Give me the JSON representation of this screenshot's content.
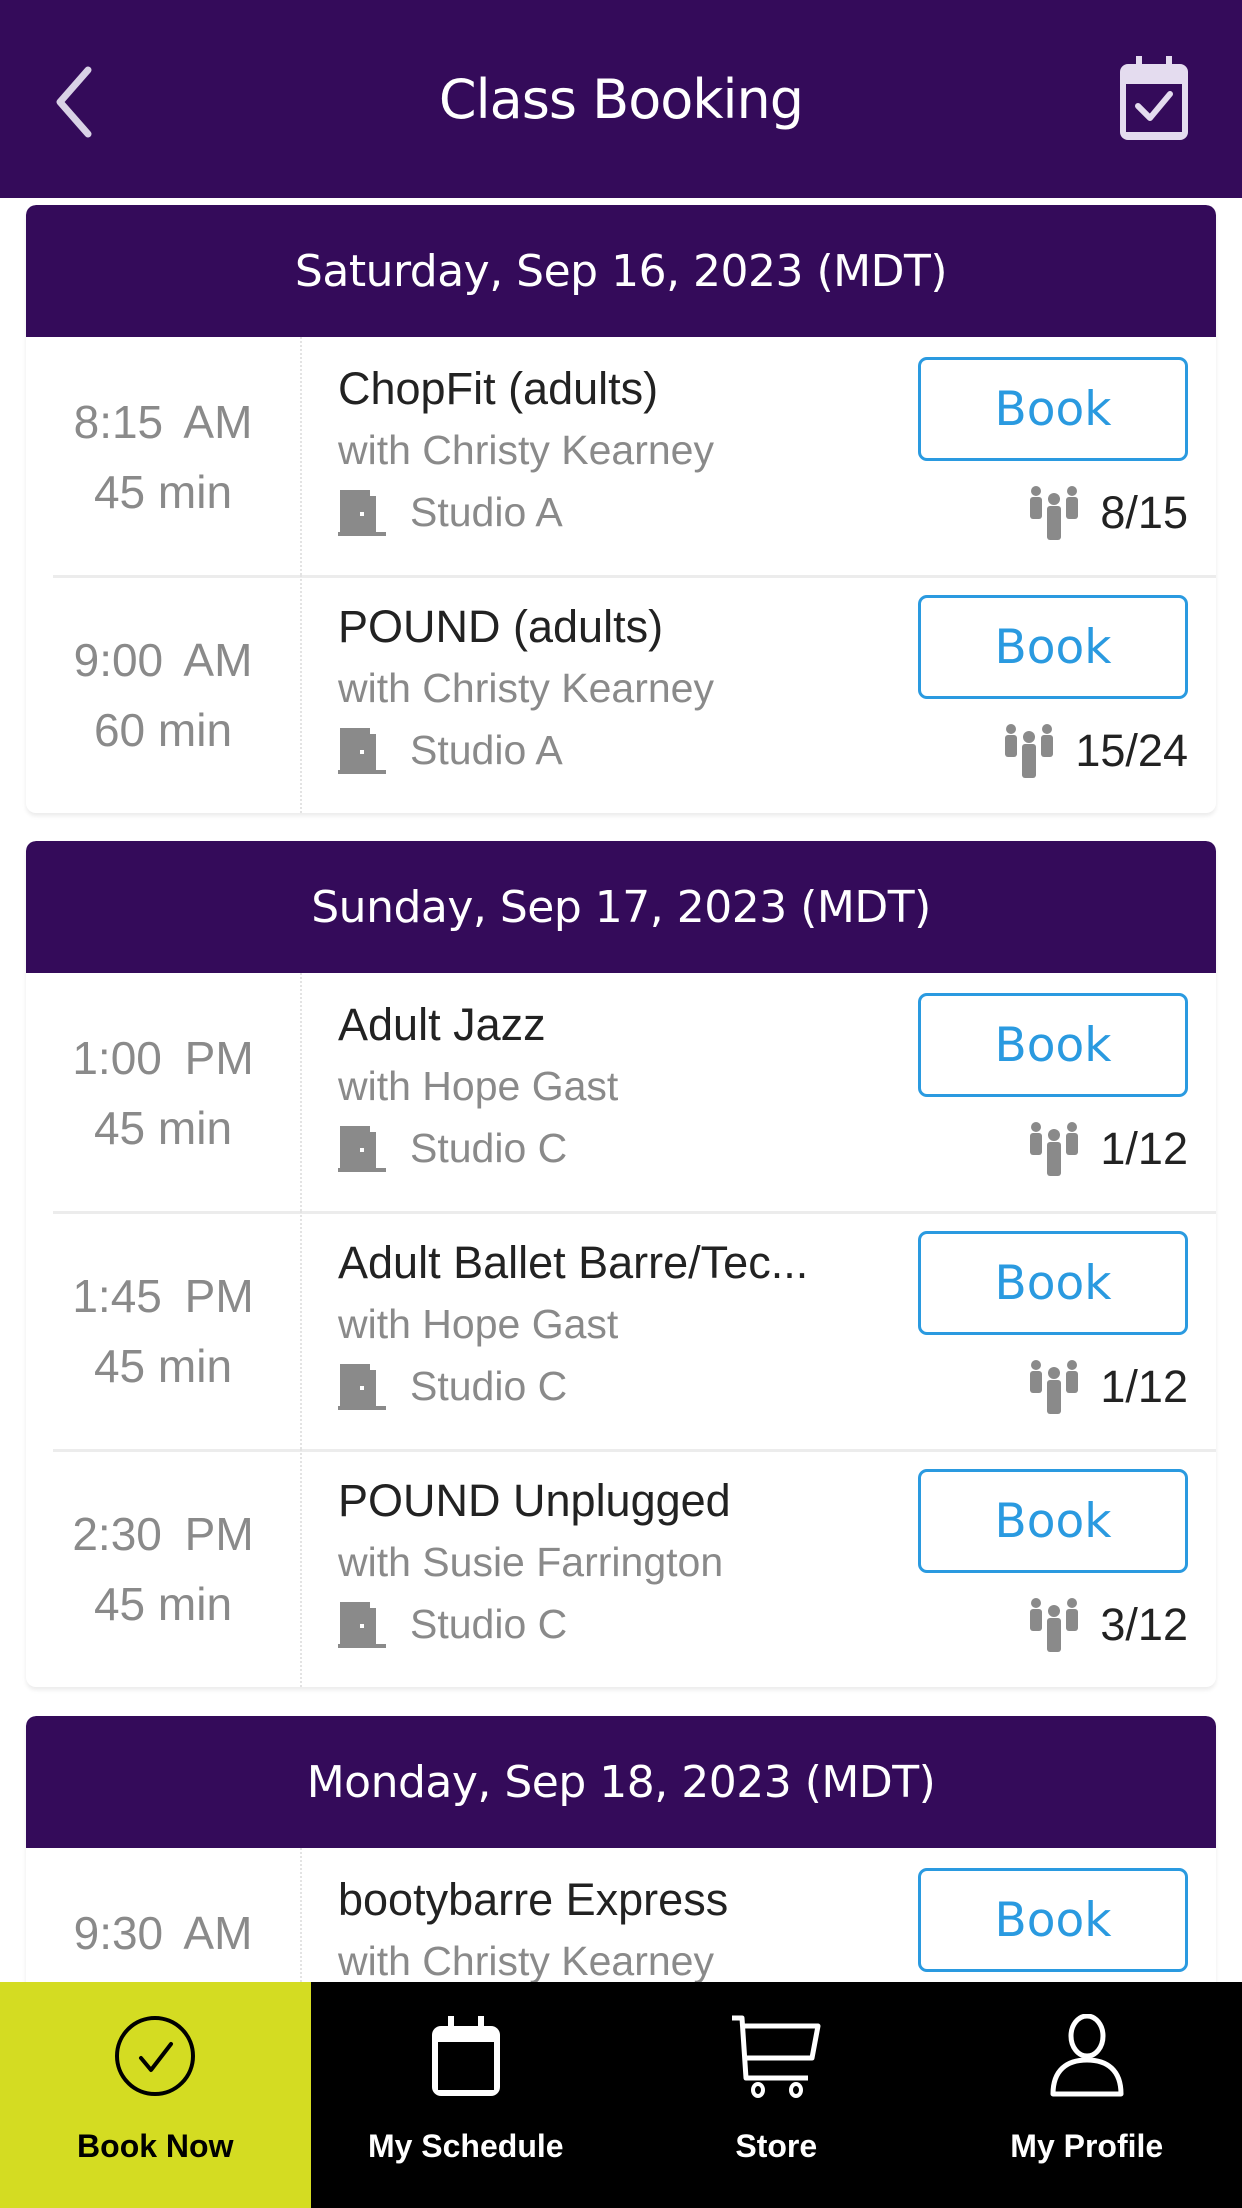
{
  "header": {
    "title": "Class Booking",
    "back_icon": "chevron-left-icon",
    "right_icon": "calendar-check-icon"
  },
  "colors": {
    "brand_purple": "#340b5a",
    "book_blue": "#2a9ae0",
    "active_tab": "#d4dc22",
    "tabbar_bg": "#000000"
  },
  "days": [
    {
      "date": "Saturday, Sep 16, 2023 (MDT)",
      "classes": [
        {
          "time": "8:15 AM",
          "duration": "45 min",
          "name": "ChopFit (adults)",
          "instructor": "with Christy Kearney",
          "location": "Studio A",
          "capacity": "8/15",
          "button": "Book"
        },
        {
          "time": "9:00 AM",
          "duration": "60 min",
          "name": "POUND (adults)",
          "instructor": "with Christy Kearney",
          "location": "Studio A",
          "capacity": "15/24",
          "button": "Book"
        }
      ]
    },
    {
      "date": "Sunday, Sep 17, 2023 (MDT)",
      "classes": [
        {
          "time": "1:00 PM",
          "duration": "45 min",
          "name": "Adult Jazz",
          "instructor": "with Hope Gast",
          "location": "Studio C",
          "capacity": "1/12",
          "button": "Book"
        },
        {
          "time": "1:45 PM",
          "duration": "45 min",
          "name": "Adult Ballet Barre/Tec...",
          "instructor": "with Hope Gast",
          "location": "Studio C",
          "capacity": "1/12",
          "button": "Book"
        },
        {
          "time": "2:30 PM",
          "duration": "45 min",
          "name": "POUND Unplugged",
          "instructor": "with Susie Farrington",
          "location": "Studio C",
          "capacity": "3/12",
          "button": "Book"
        }
      ]
    },
    {
      "date": "Monday, Sep 18, 2023 (MDT)",
      "classes": [
        {
          "time": "9:30 AM",
          "duration": "",
          "name": "bootybarre Express",
          "instructor": "with Christy Kearney",
          "location": "",
          "capacity": "",
          "button": "Book"
        }
      ]
    }
  ],
  "tabs": [
    {
      "label": "Book Now",
      "icon": "check-circle-icon",
      "active": true
    },
    {
      "label": "My Schedule",
      "icon": "calendar-icon",
      "active": false
    },
    {
      "label": "Store",
      "icon": "cart-icon",
      "active": false
    },
    {
      "label": "My Profile",
      "icon": "person-icon",
      "active": false
    }
  ]
}
